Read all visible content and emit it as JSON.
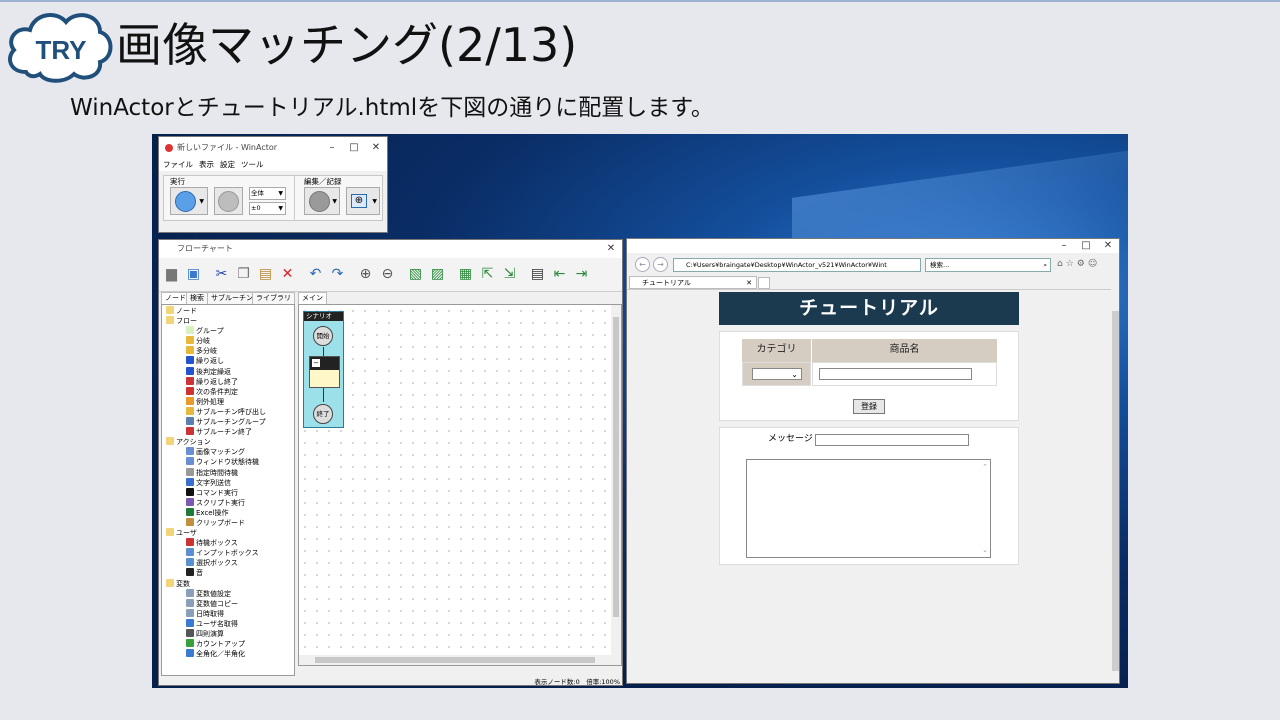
{
  "slide": {
    "badge": "TRY",
    "title": "画像マッチング(2/13)",
    "subtitle": "WinActorとチュートリアル.htmlを下図の通りに配置します。"
  },
  "winactor": {
    "window_title": "新しいファイル - WinActor",
    "menu": [
      "ファイル",
      "表示",
      "設定",
      "ツール"
    ],
    "group_run": "実行",
    "group_edit": "編集／記録",
    "select_all": "全体",
    "select_speed": "±0"
  },
  "flowchart": {
    "window_title": "フローチャート",
    "tabs": [
      "ノード",
      "検索",
      "サブルーチン",
      "ライブラリ"
    ],
    "canvas_tab": "メイン",
    "scenario_label": "シナリオ",
    "start_node": "開始",
    "end_node": "終了",
    "status": "表示ノード数:0　倍率:100%",
    "tree": [
      {
        "depth": 0,
        "label": "ノード",
        "icon": "folder-icon",
        "color": "#f2d479"
      },
      {
        "depth": 0,
        "label": "フロー",
        "icon": "folder-icon",
        "color": "#f2d479"
      },
      {
        "depth": 1,
        "label": "グループ",
        "icon": "group-icon",
        "color": "#d9f0c0"
      },
      {
        "depth": 1,
        "label": "分岐",
        "icon": "branch-icon",
        "color": "#e8b83a"
      },
      {
        "depth": 1,
        "label": "多分岐",
        "icon": "multi-branch-icon",
        "color": "#e8b83a"
      },
      {
        "depth": 1,
        "label": "繰り返し",
        "icon": "loop-icon",
        "color": "#2255cc"
      },
      {
        "depth": 1,
        "label": "後判定繰返",
        "icon": "loop-icon",
        "color": "#2255cc"
      },
      {
        "depth": 1,
        "label": "繰り返し終了",
        "icon": "loop-end-icon",
        "color": "#cc3333"
      },
      {
        "depth": 1,
        "label": "次の条件判定",
        "icon": "next-condition-icon",
        "color": "#cc3333"
      },
      {
        "depth": 1,
        "label": "例外処理",
        "icon": "exception-icon",
        "color": "#e89a2a"
      },
      {
        "depth": 1,
        "label": "サブルーチン呼び出し",
        "icon": "subroutine-call-icon",
        "color": "#e8b83a"
      },
      {
        "depth": 1,
        "label": "サブルーチングループ",
        "icon": "subroutine-group-icon",
        "color": "#5a7fb0"
      },
      {
        "depth": 1,
        "label": "サブルーチン終了",
        "icon": "subroutine-end-icon",
        "color": "#cc3333"
      },
      {
        "depth": 0,
        "label": "アクション",
        "icon": "folder-icon",
        "color": "#f2d479"
      },
      {
        "depth": 1,
        "label": "画像マッチング",
        "icon": "image-match-icon",
        "color": "#6a8fd0"
      },
      {
        "depth": 1,
        "label": "ウィンドウ状態待機",
        "icon": "window-wait-icon",
        "color": "#6a8fd0"
      },
      {
        "depth": 1,
        "label": "指定時間待機",
        "icon": "timer-icon",
        "color": "#999999"
      },
      {
        "depth": 1,
        "label": "文字列送信",
        "icon": "text-send-icon",
        "color": "#3a6fd0"
      },
      {
        "depth": 1,
        "label": "コマンド実行",
        "icon": "command-icon",
        "color": "#111111"
      },
      {
        "depth": 1,
        "label": "スクリプト実行",
        "icon": "script-icon",
        "color": "#7a5ab0"
      },
      {
        "depth": 1,
        "label": "Excel操作",
        "icon": "excel-icon",
        "color": "#1e7b3a"
      },
      {
        "depth": 1,
        "label": "クリップボード",
        "icon": "clipboard-icon",
        "color": "#c09040"
      },
      {
        "depth": 0,
        "label": "ユーザ",
        "icon": "folder-icon",
        "color": "#f2d479"
      },
      {
        "depth": 1,
        "label": "待機ボックス",
        "icon": "wait-box-icon",
        "color": "#cc3333"
      },
      {
        "depth": 1,
        "label": "インプットボックス",
        "icon": "input-box-icon",
        "color": "#5a8fd0"
      },
      {
        "depth": 1,
        "label": "選択ボックス",
        "icon": "select-box-icon",
        "color": "#5a8fd0"
      },
      {
        "depth": 1,
        "label": "音",
        "icon": "sound-icon",
        "color": "#222222"
      },
      {
        "depth": 0,
        "label": "変数",
        "icon": "folder-icon",
        "color": "#f2d479"
      },
      {
        "depth": 1,
        "label": "変数値設定",
        "icon": "var-set-icon",
        "color": "#8aa0b8"
      },
      {
        "depth": 1,
        "label": "変数値コピー",
        "icon": "var-copy-icon",
        "color": "#8aa0b8"
      },
      {
        "depth": 1,
        "label": "日時取得",
        "icon": "clock-icon",
        "color": "#8aa0b8"
      },
      {
        "depth": 1,
        "label": "ユーザ名取得",
        "icon": "user-icon",
        "color": "#3a7ad0"
      },
      {
        "depth": 1,
        "label": "四則演算",
        "icon": "calc-icon",
        "color": "#555555"
      },
      {
        "depth": 1,
        "label": "カウントアップ",
        "icon": "count-up-icon",
        "color": "#3aa03a"
      },
      {
        "depth": 1,
        "label": "全角化／半角化",
        "icon": "width-convert-icon",
        "color": "#3a7ad0"
      }
    ]
  },
  "browser": {
    "address": "C:¥Users¥braingate¥Desktop¥WinActor_v521¥WinActor¥Wint",
    "search_placeholder": "検索...",
    "tab_title": "チュートリアル",
    "page": {
      "header": "チュートリアル",
      "col_category": "カテゴリ",
      "col_product": "商品名",
      "register_button": "登録",
      "message_label": "メッセージ"
    }
  },
  "colors": {
    "header_bg": "#1b3a50",
    "table_header": "#d6cdc2",
    "desktop": "#0a2d66"
  }
}
